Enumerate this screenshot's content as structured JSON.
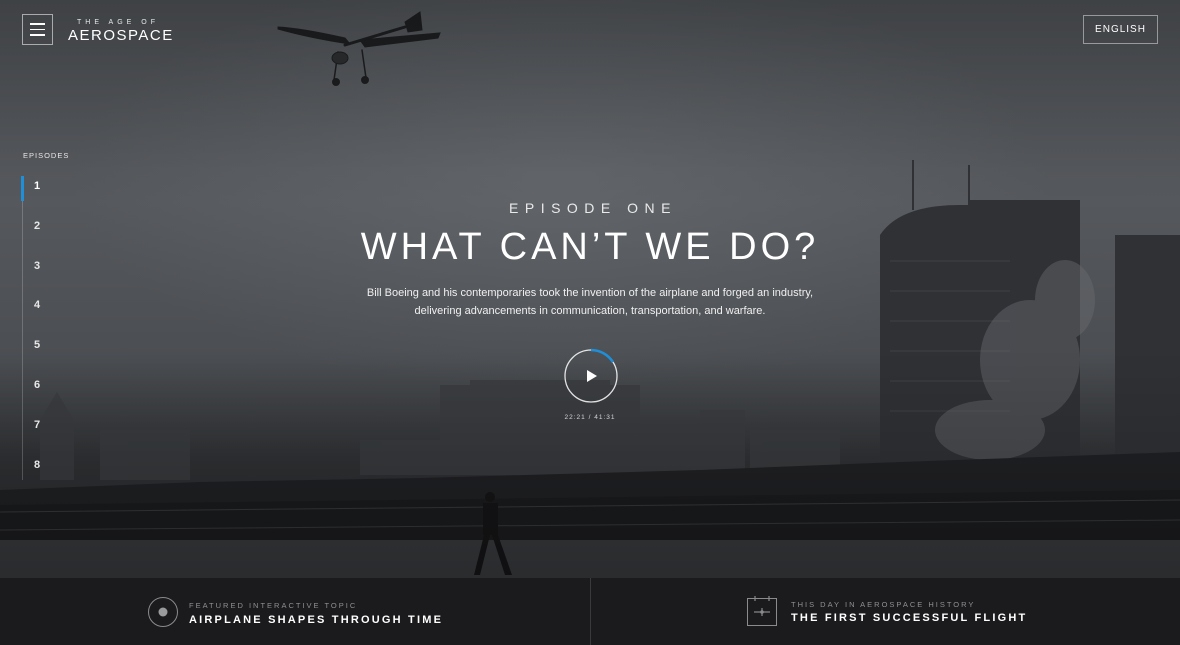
{
  "header": {
    "logo_small": "THE AGE OF",
    "logo_big": "AEROSPACE",
    "menu_icon": "hamburger-icon",
    "language_label": "ENGLISH"
  },
  "episodes_nav": {
    "title": "EPISODES",
    "items": [
      "1",
      "2",
      "3",
      "4",
      "5",
      "6",
      "7",
      "8"
    ],
    "active_index": 0,
    "accent_color": "#1e8fd8"
  },
  "episode": {
    "kicker": "EPISODE ONE",
    "title": "WHAT CAN’T WE DO?",
    "description_line1": "Bill Boeing and his contemporaries took the invention of the airplane and forged an industry,",
    "description_line2": "delivering advancements in communication, transportation, and warfare.",
    "play_icon": "play-icon",
    "current_time": "22:21",
    "separator": "/",
    "duration": "41:31",
    "progress_fraction": 0.54,
    "progress_color": "#1e8fd8"
  },
  "footer": {
    "featured": {
      "icon": "target-icon",
      "kicker": "FEATURED INTERACTIVE TOPIC",
      "headline": "AIRPLANE SHAPES THROUGH TIME"
    },
    "history": {
      "icon": "calendar-plane-icon",
      "kicker": "THIS DAY IN AEROSPACE HISTORY",
      "headline": "THE FIRST SUCCESSFUL FLIGHT"
    }
  }
}
